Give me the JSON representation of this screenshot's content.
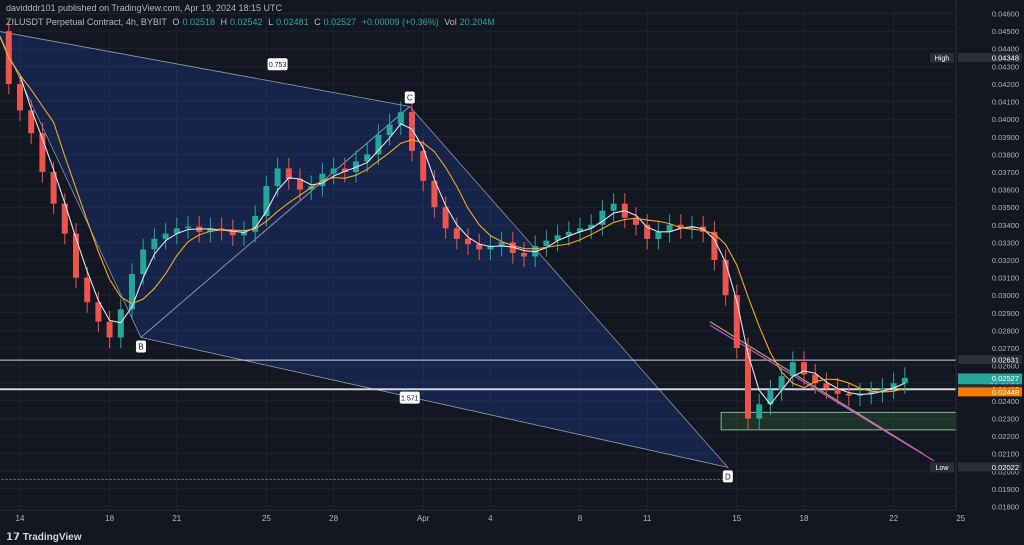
{
  "header": {
    "publisher_line": "davidddr101 published on TradingView.com, Apr 19, 2024 18:15 UTC",
    "symbol": "ZILUSDT Perpetual Contract, 4h, BYBIT",
    "open_label": "O",
    "open": "0.02518",
    "high_label": "H",
    "high": "0.02542",
    "low_label": "L",
    "low": "0.02481",
    "close_label": "C",
    "close": "0.02527",
    "change": "+0.00009 (+0.36%)",
    "vol_label": "Vol",
    "vol": "20.204M"
  },
  "footer": {
    "brand": "TradingView",
    "brand_mark": "𝟭𝟳"
  },
  "chart_data": {
    "type": "line",
    "price_axis": {
      "ticks": [
        "0.04600",
        "0.04500",
        "0.04400",
        "0.04300",
        "0.04200",
        "0.04100",
        "0.04000",
        "0.03900",
        "0.03800",
        "0.03700",
        "0.03600",
        "0.03500",
        "0.03400",
        "0.03300",
        "0.03200",
        "0.03100",
        "0.03000",
        "0.02900",
        "0.02800",
        "0.02700",
        "0.02600",
        "0.02500",
        "0.02400",
        "0.02300",
        "0.02200",
        "0.02100",
        "0.02000",
        "0.01900",
        "0.01800"
      ],
      "ylim": [
        0.0178,
        0.0462
      ]
    },
    "time_axis": {
      "ticks": [
        "14",
        "18",
        "21",
        "25",
        "28",
        "Apr",
        "4",
        "8",
        "11",
        "15",
        "18",
        "22",
        "25"
      ],
      "tick_days": [
        0,
        4,
        7,
        11,
        14,
        18,
        21,
        25,
        28,
        32,
        35,
        39,
        42
      ]
    },
    "price_labels": [
      {
        "text": "High",
        "value": "0.04348",
        "price": 0.04348,
        "color": "#2a2e39"
      },
      {
        "text": "",
        "value": "0.02631",
        "price": 0.02631,
        "color": "#2a2e39"
      },
      {
        "text": "",
        "value": "0.02527",
        "price": 0.02527,
        "color": "#26a69a",
        "sub": "01:44:04"
      },
      {
        "text": "",
        "value": "0.02466",
        "price": 0.02466,
        "color": "#2a2e39"
      },
      {
        "text": "",
        "value": "0.02465",
        "price": 0.02465,
        "color": "#2a2e39"
      },
      {
        "text": "",
        "value": "0.02448",
        "price": 0.02448,
        "color": "#f57c00"
      },
      {
        "text": "Low",
        "value": "0.02022",
        "price": 0.02022,
        "color": "#2a2e39"
      }
    ],
    "harmonic_points": [
      {
        "label": "",
        "day": -1,
        "price": 0.045
      },
      {
        "label": "B",
        "day": 5.4,
        "price": 0.0276
      },
      {
        "label": "C",
        "day": 17.4,
        "price": 0.04072
      },
      {
        "label": "D",
        "day": 31.6,
        "price": 0.02022
      }
    ],
    "ratios": [
      {
        "text": "0.753",
        "day": 11.5,
        "price": 0.04312
      },
      {
        "text": "1.571",
        "day": 17.4,
        "price": 0.02418
      }
    ],
    "horizontal_levels": [
      0.02631,
      0.02466
    ],
    "series": [
      {
        "name": "",
        "values": [
          0.045,
          0.042,
          0.0405,
          0.0392,
          0.037,
          0.0352,
          0.0335,
          0.031,
          0.0296,
          0.0285,
          0.0276,
          0.0292,
          0.0312,
          0.0326,
          0.0332,
          0.0335,
          0.0338,
          0.0339,
          0.0336,
          0.0338,
          0.0337,
          0.0334,
          0.0336,
          0.0345,
          0.0362,
          0.0372,
          0.0366,
          0.036,
          0.0362,
          0.0369,
          0.0372,
          0.037,
          0.0376,
          0.038,
          0.0391,
          0.0397,
          0.0404,
          0.0382,
          0.0365,
          0.035,
          0.0338,
          0.0332,
          0.0329,
          0.0326,
          0.0328,
          0.033,
          0.0324,
          0.0322,
          0.0328,
          0.0331,
          0.0334,
          0.0336,
          0.0338,
          0.034,
          0.0348,
          0.0352,
          0.0344,
          0.034,
          0.0332,
          0.0336,
          0.034,
          0.0338,
          0.0339,
          0.0336,
          0.032,
          0.03,
          0.027,
          0.023,
          0.0238,
          0.0246,
          0.0254,
          0.0262,
          0.0255,
          0.025,
          0.0247,
          0.0244,
          0.0243,
          0.0244,
          0.0245,
          0.0247,
          0.025,
          0.0253
        ],
        "x_start": -1.0,
        "x_step": 0.5
      }
    ]
  }
}
